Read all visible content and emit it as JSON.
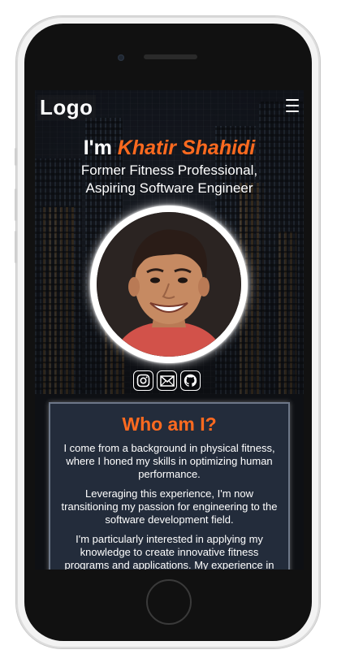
{
  "brand": {
    "logo_text": "Logo"
  },
  "hero": {
    "greeting": "I'm",
    "name": "Khatir Shahidi",
    "subtitle_line1": "Former Fitness Professional,",
    "subtitle_line2": "Aspiring Software Engineer"
  },
  "socials": [
    {
      "icon": "instagram-icon"
    },
    {
      "icon": "mail-icon"
    },
    {
      "icon": "github-icon"
    }
  ],
  "about": {
    "title": "Who am I?",
    "paragraphs": [
      "I come from a background in physical fitness, where I honed my skills in optimizing human performance.",
      "Leveraging this experience, I'm now transitioning my passion for engineering to the software development field.",
      "I'm particularly interested in applying my knowledge to create innovative fitness programs and applications. My experience in"
    ]
  },
  "colors": {
    "accent": "#ff6a1f",
    "card_background": "#232c3b",
    "hero_background": "#151922"
  }
}
